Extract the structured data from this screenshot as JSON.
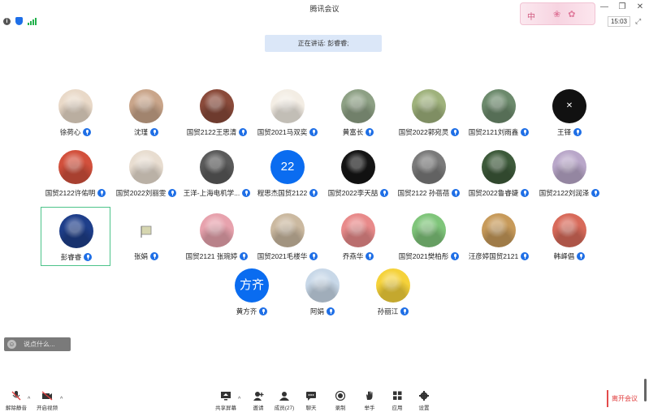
{
  "window": {
    "title": "腾讯会议"
  },
  "ime": {
    "mode": "中"
  },
  "clock": "15:03",
  "speaking": {
    "label": "正在讲话: 彭睿睿;"
  },
  "participants": [
    {
      "name": "徐荷心",
      "avatar": "cartoon-bear",
      "color": "#e9d9c8"
    },
    {
      "name": "沈瑾",
      "avatar": "photo",
      "color": "#c9a58a"
    },
    {
      "name": "国贸2122王思清",
      "avatar": "teddy",
      "color": "#8a4a3a"
    },
    {
      "name": "国贸2021马双奕",
      "avatar": "sketch",
      "color": "#f3ede4"
    },
    {
      "name": "黄富长",
      "avatar": "photo",
      "color": "#8da084"
    },
    {
      "name": "国贸2022郭宛灵",
      "avatar": "photo",
      "color": "#9fb27c"
    },
    {
      "name": "国贸2121刘雨鑫",
      "avatar": "photo",
      "color": "#6c8a6c"
    },
    {
      "name": "王铎",
      "avatar": "never-logo",
      "color": "#111111"
    },
    {
      "name": "国贸2122许佑明",
      "avatar": "photo",
      "color": "#d2503c"
    },
    {
      "name": "国贸2022刘丽雯",
      "avatar": "photo",
      "color": "#e8ddd0"
    },
    {
      "name": "王洋-上海电机学...",
      "avatar": "photo",
      "color": "#5a5a5a"
    },
    {
      "name": "程思杰国贸2122",
      "avatar": "text",
      "avatar_text": "22",
      "color": "#0a6cf0"
    },
    {
      "name": "国贸2022李天喆",
      "avatar": "photo",
      "color": "#151515"
    },
    {
      "name": "国贸2122 孙蓓蓓",
      "avatar": "photo",
      "color": "#7a7a7a"
    },
    {
      "name": "国贸2022鲁睿婕",
      "avatar": "photo",
      "color": "#3d5a3a"
    },
    {
      "name": "国贸2122刘润泽",
      "avatar": "photo",
      "color": "#b9a7c9"
    },
    {
      "name": "彭睿睿",
      "avatar": "photo",
      "color": "#1e3e8a"
    },
    {
      "name": "张娟",
      "avatar": "small-icon",
      "color": "#f2f2f2"
    },
    {
      "name": "国贸2121 张琬婷",
      "avatar": "anime",
      "color": "#e7a2ad"
    },
    {
      "name": "国贸2021毛楼华",
      "avatar": "anime",
      "color": "#cbb9a0"
    },
    {
      "name": "乔燕华",
      "avatar": "cake",
      "color": "#e88a8a"
    },
    {
      "name": "国贸2021樊柏彤",
      "avatar": "anime",
      "color": "#7fc57a"
    },
    {
      "name": "汪彦婷国贸2121",
      "avatar": "photo",
      "color": "#c79a5a"
    },
    {
      "name": "韩峄倡",
      "avatar": "cartoon",
      "color": "#d86a5a"
    },
    {
      "name": "黄方齐",
      "avatar": "text",
      "avatar_text": "方齐",
      "color": "#0a6cf0"
    },
    {
      "name": "阿娟",
      "avatar": "photo",
      "color": "#c8d8e8"
    },
    {
      "name": "孙丽江",
      "avatar": "cartoon-bird",
      "color": "#f5d23a"
    }
  ],
  "chat": {
    "placeholder": "说点什么..."
  },
  "toolbar": {
    "mute": "解除静音",
    "video": "开启视频",
    "share": "共享屏幕",
    "invite": "邀请",
    "members": "成员(27)",
    "chat": "聊天",
    "record": "录制",
    "raise_hand": "举手",
    "apps": "应用",
    "settings": "设置",
    "leave": "离开会议"
  },
  "colors": {
    "accent": "#1f6fe6",
    "leave": "#e03c3c",
    "active_border": "#4cc38a"
  }
}
